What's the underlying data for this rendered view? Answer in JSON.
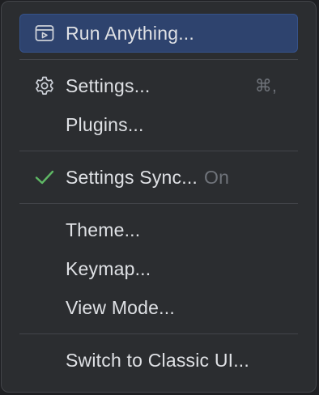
{
  "menu": {
    "run_anything": {
      "label": "Run Anything...",
      "icon": "run-anything-icon"
    },
    "settings": {
      "label": "Settings...",
      "icon": "gear-icon",
      "shortcut": "⌘,"
    },
    "plugins": {
      "label": "Plugins..."
    },
    "settings_sync": {
      "label": "Settings Sync...",
      "status": "On",
      "icon": "checkmark-icon"
    },
    "theme": {
      "label": "Theme..."
    },
    "keymap": {
      "label": "Keymap..."
    },
    "view_mode": {
      "label": "View Mode..."
    },
    "switch_ui": {
      "label": "Switch to Classic UI..."
    }
  },
  "colors": {
    "background": "#2b2d30",
    "selection": "#2e436e",
    "text": "#dfe1e5",
    "muted": "#6f737a",
    "check": "#5fb865",
    "separator": "#43454a"
  }
}
